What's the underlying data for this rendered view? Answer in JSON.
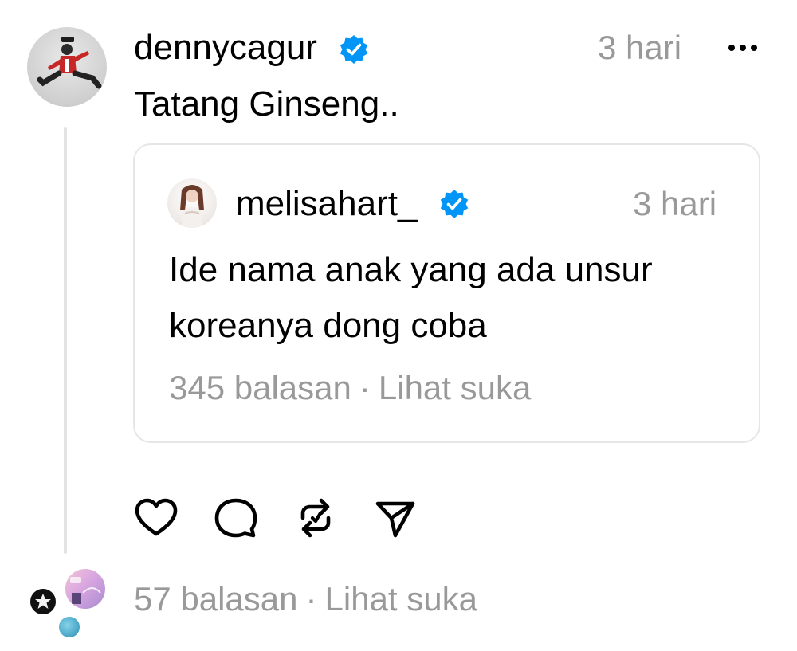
{
  "post": {
    "username": "dennycagur",
    "time": "3 hari",
    "text": "Tatang Ginseng..",
    "more_icon": "more-icon"
  },
  "quote": {
    "username": "melisahart_",
    "time": "3 hari",
    "text": "Ide nama anak yang ada unsur koreanya dong coba",
    "replies": "345 balasan",
    "separator": "·",
    "likes": "Lihat suka"
  },
  "actions": {
    "icons": [
      "heart-icon",
      "comment-icon",
      "repost-icon",
      "share-icon"
    ]
  },
  "footer": {
    "replies": "57 balasan",
    "separator": "·",
    "likes": "Lihat suka"
  },
  "colors": {
    "verified": "#0095f6",
    "muted_text": "#999999",
    "border": "#e6e6e6"
  }
}
